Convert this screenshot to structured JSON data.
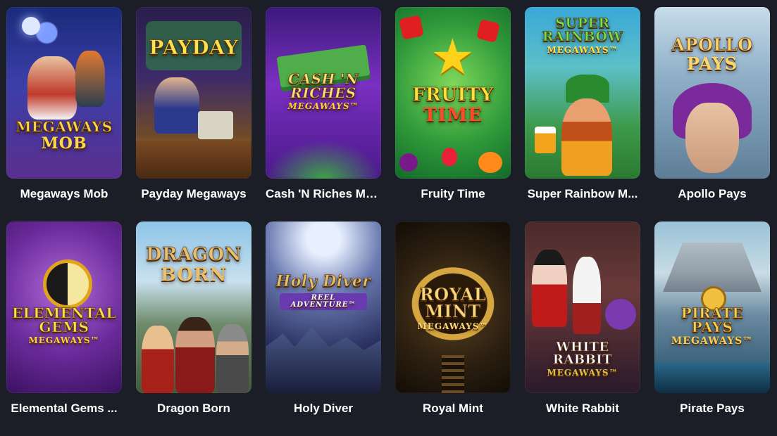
{
  "games": [
    {
      "title": "Megaways Mob",
      "logo": "MEGAWAYS",
      "logo_sub": "MOB"
    },
    {
      "title": "Payday Megaways",
      "logo": "PAYDAY",
      "logo_sub": ""
    },
    {
      "title": "Cash 'N Riches Me...",
      "logo": "CASH 'N RICHES",
      "logo_sub": "MEGAWAYS™"
    },
    {
      "title": "Fruity Time",
      "logo": "FRUITY",
      "logo_sub": "TIME"
    },
    {
      "title": "Super Rainbow M...",
      "logo": "SUPER RAINBOW",
      "logo_sub": "MEGAWAYS™"
    },
    {
      "title": "Apollo Pays",
      "logo": "APOLLO",
      "logo_sub": "PAYS"
    },
    {
      "title": "Elemental Gems ...",
      "logo": "ELEMENTAL GEMS",
      "logo_sub": "MEGAWAYS™"
    },
    {
      "title": "Dragon Born",
      "logo": "DRAGON",
      "logo_sub": "BORN"
    },
    {
      "title": "Holy Diver",
      "logo": "Holy Diver",
      "logo_sub": "REEL ADVENTURE™"
    },
    {
      "title": "Royal Mint",
      "logo": "ROYAL MINT",
      "logo_sub": "MEGAWAYS™"
    },
    {
      "title": "White Rabbit",
      "logo": "WHITE RABBIT",
      "logo_sub": "MEGAWAYS™"
    },
    {
      "title": "Pirate Pays",
      "logo": "PIRATE PAYS",
      "logo_sub": "MEGAWAYS™"
    }
  ]
}
